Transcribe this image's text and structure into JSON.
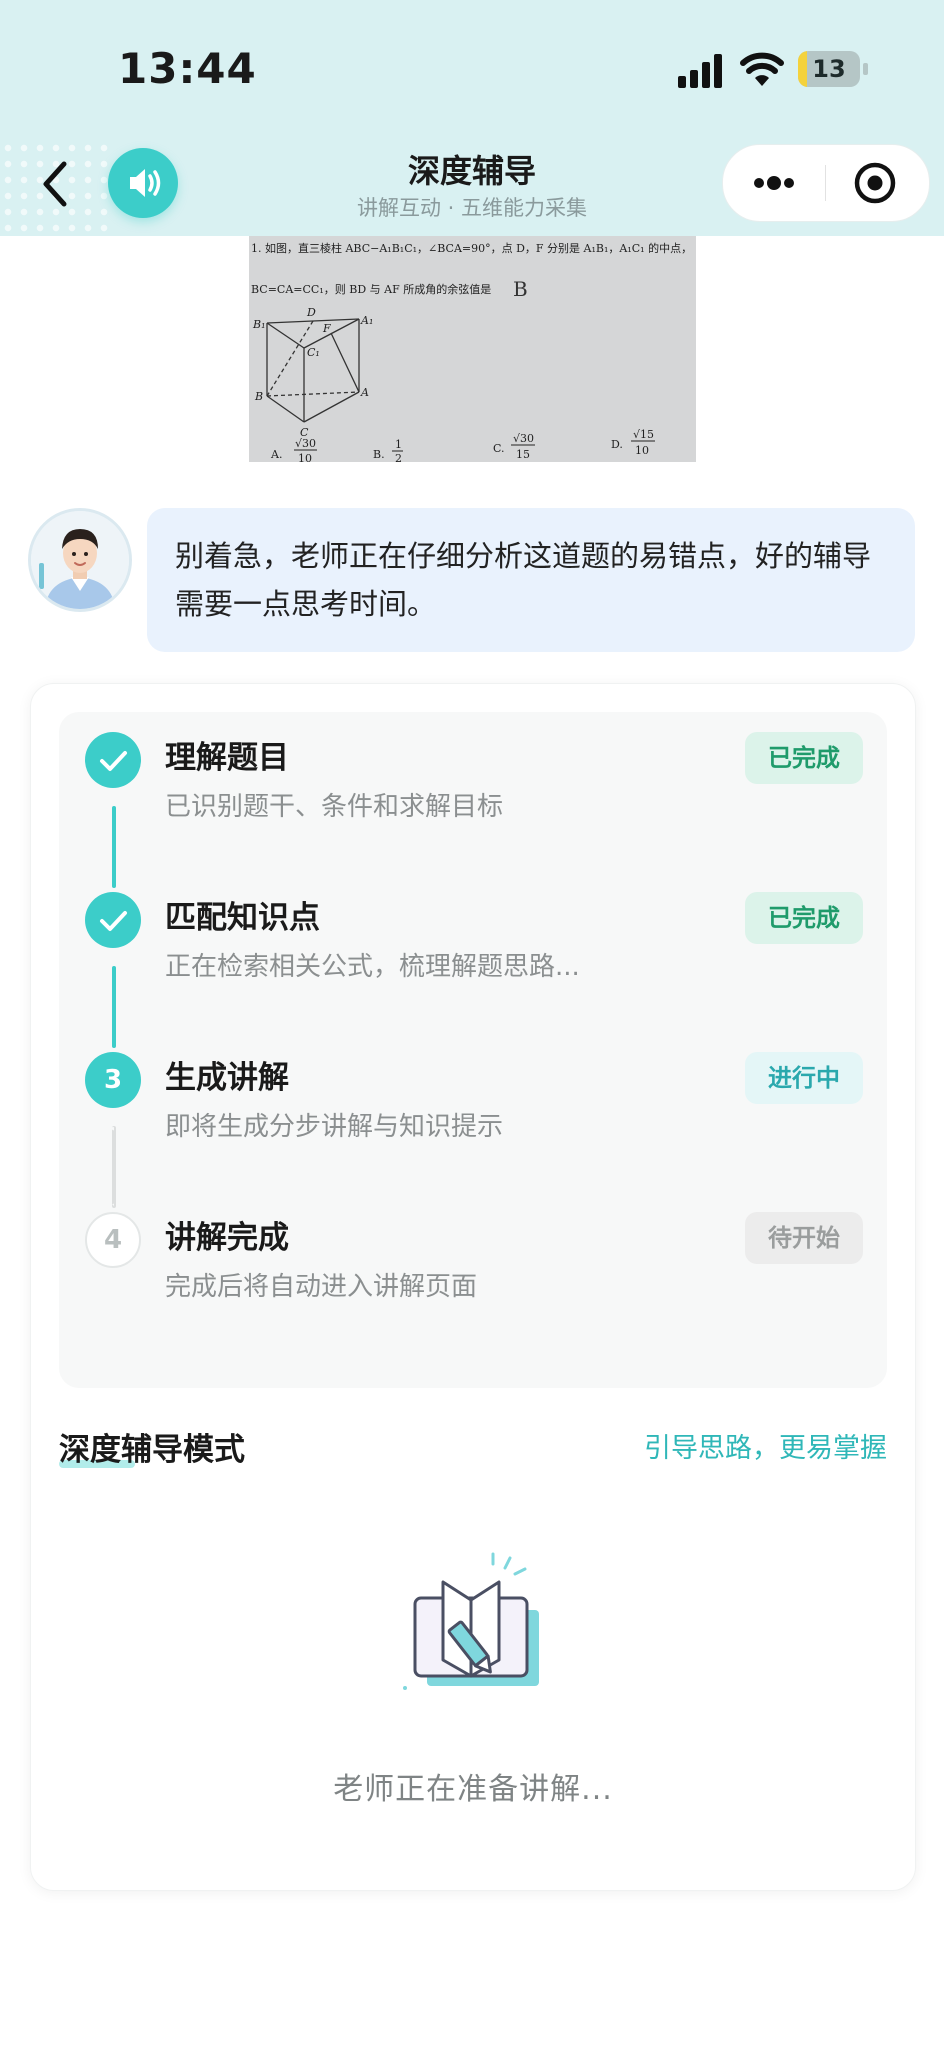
{
  "status_bar": {
    "time": "13:44",
    "battery": "13"
  },
  "nav": {
    "title": "深度辅导",
    "subtitle": "讲解互动 · 五维能力采集"
  },
  "question": {
    "line1": "1. 如图，直三棱柱 ABC−A₁B₁C₁，∠BCA=90°，点 D，F 分别是 A₁B₁，A₁C₁ 的中点，",
    "line2": "BC=CA=CC₁，则 BD 与 AF 所成角的余弦值是",
    "answer_mark": "B",
    "vertices": [
      "B₁",
      "D",
      "A₁",
      "F",
      "C₁",
      "B",
      "A",
      "C"
    ],
    "option_a_label": "A.",
    "option_a_num": "√30",
    "option_a_den": "10",
    "option_b_label": "B.",
    "option_b_num": "1",
    "option_b_den": "2",
    "option_c_label": "C.",
    "option_c_num": "√30",
    "option_c_den": "15",
    "option_d_label": "D.",
    "option_d_num": "√15",
    "option_d_den": "10"
  },
  "message": {
    "text": "别着急，老师正在仔细分析这道题的易错点，好的辅导需要一点思考时间。"
  },
  "steps": [
    {
      "index": "1",
      "title": "理解题目",
      "desc": "已识别题干、条件和求解目标",
      "status": "已完成"
    },
    {
      "index": "2",
      "title": "匹配知识点",
      "desc": "正在检索相关公式，梳理解题思路...",
      "status": "已完成"
    },
    {
      "index": "3",
      "title": "生成讲解",
      "desc": "即将生成分步讲解与知识提示",
      "status": "进行中"
    },
    {
      "index": "4",
      "title": "讲解完成",
      "desc": "完成后将自动进入讲解页面",
      "status": "待开始"
    }
  ],
  "mode": {
    "title": "深度辅导模式",
    "hint": "引导思路，更易掌握",
    "preparing": "老师正在准备讲解..."
  },
  "colors": {
    "accent": "#3ccdc9",
    "header_bg": "#d9f1f2",
    "bubble_bg": "#e9f2fd",
    "done": "#1f9b6b",
    "in_progress": "#2aa8ad"
  }
}
